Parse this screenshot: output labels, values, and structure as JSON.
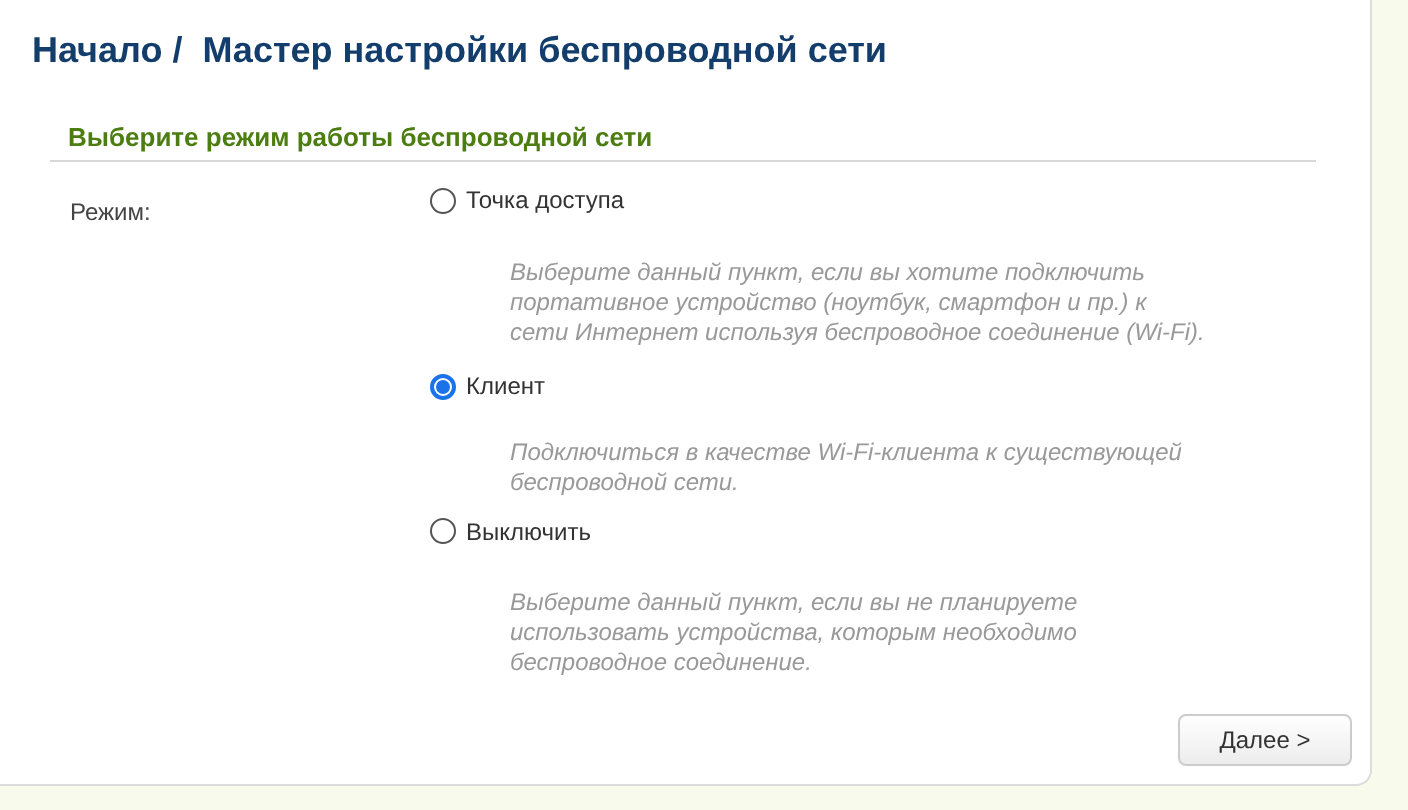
{
  "breadcrumb": {
    "home": "Начало /",
    "title": "Мастер настройки беспроводной сети"
  },
  "section": {
    "title": "Выберите режим работы беспроводной сети",
    "field_label": "Режим:",
    "options": [
      {
        "label": "Точка доступа",
        "selected": false,
        "description": "Выберите данный пункт, если вы хотите подключить портативное устройство (ноутбук, смартфон и пр.) к сети Интернет используя беспроводное соединение (Wi-Fi)."
      },
      {
        "label": "Клиент",
        "selected": true,
        "description": "Подключиться в качестве Wi-Fi-клиента к существующей беспроводной сети."
      },
      {
        "label": "Выключить",
        "selected": false,
        "description": "Выберите данный пункт, если вы не планируете использовать устройства, которым необходимо беспроводное соединение."
      }
    ]
  },
  "buttons": [
    {
      "label": "Далее >"
    }
  ]
}
